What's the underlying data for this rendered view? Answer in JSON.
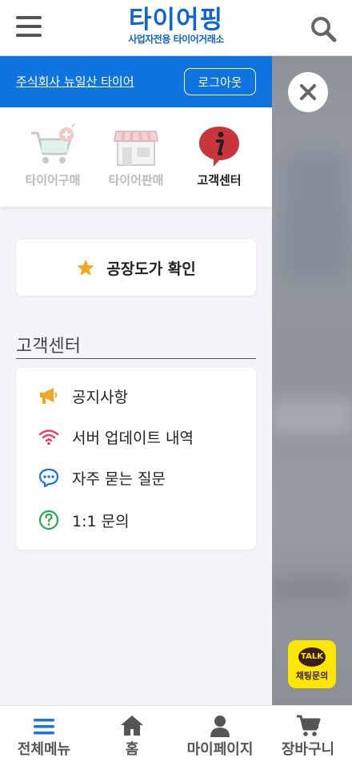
{
  "header": {
    "logo_main": "타이어핑",
    "logo_sub": "사업자전용 타이어거래소"
  },
  "drawer": {
    "company_name": "주식회사 뉴일산 타이어",
    "logout_label": "로그아웃",
    "quick_menu": [
      {
        "label": "타이어구매",
        "icon": "shopping-cart-plus-icon",
        "active": false
      },
      {
        "label": "타이어판매",
        "icon": "store-icon",
        "active": false
      },
      {
        "label": "고객센터",
        "icon": "info-icon",
        "active": true
      }
    ],
    "factory_check_label": "공장도가 확인",
    "section_title": "고객센터",
    "menu": [
      {
        "label": "공지사항",
        "icon": "megaphone-icon"
      },
      {
        "label": "서버 업데이트 내역",
        "icon": "wifi-icon"
      },
      {
        "label": "자주 묻는 질문",
        "icon": "chat-bubble-icon"
      },
      {
        "label": "1:1 문의",
        "icon": "question-circle-icon"
      }
    ]
  },
  "kakao": {
    "bubble": "TALK",
    "label": "채팅문의"
  },
  "bottom_nav": [
    {
      "label": "전체메뉴",
      "icon": "menu-icon",
      "active": true
    },
    {
      "label": "홈",
      "icon": "home-icon",
      "active": false
    },
    {
      "label": "마이페이지",
      "icon": "person-icon",
      "active": false
    },
    {
      "label": "장바구니",
      "icon": "cart-icon",
      "active": false
    }
  ],
  "colors": {
    "brand_blue": "#0f65d6",
    "user_bar": "#0f74e0",
    "kakao_yellow": "#fde600",
    "star": "#f5a623"
  }
}
